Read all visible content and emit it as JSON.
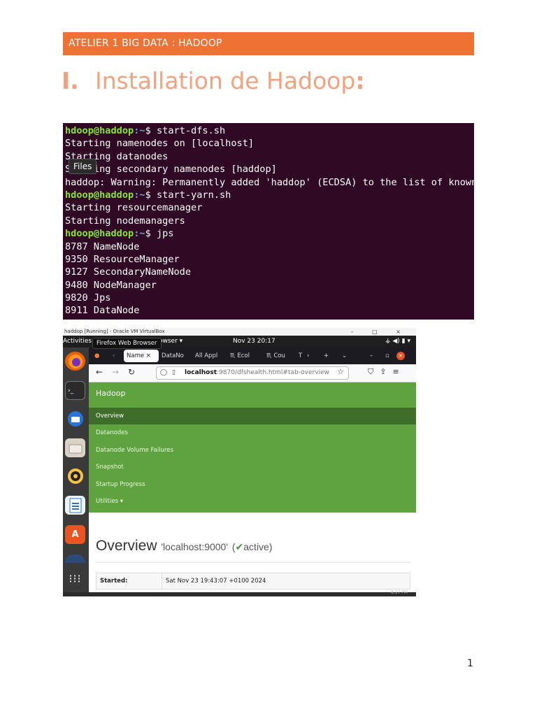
{
  "header": {
    "title": "ATELIER 1 BIG DATA : HADOOP"
  },
  "section": {
    "number": "I.",
    "title": "Installation de Hadoop",
    "colon": ":"
  },
  "terminal": {
    "lines": [
      {
        "user": "hdoop@haddop",
        "path": ":~",
        "text": "$ start-dfs.sh"
      },
      {
        "text": "Starting namenodes on [localhost]"
      },
      {
        "text": "Starting datanodes"
      },
      {
        "text": "Starting secondary namenodes [haddop]"
      },
      {
        "text": "haddop: Warning: Permanently added 'haddop' (ECDSA) to the list of known hosts."
      },
      {
        "user": "hdoop@haddop",
        "path": ":~",
        "text": "$ start-yarn.sh"
      },
      {
        "text": "Starting resourcemanager"
      },
      {
        "text": "Starting nodemanagers"
      },
      {
        "user": "hdoop@haddop",
        "path": ":~",
        "text": "$ jps"
      },
      {
        "text": "8787 NameNode"
      },
      {
        "text": "9350 ResourceManager"
      },
      {
        "text": "9127 SecondaryNameNode"
      },
      {
        "text": "9480 NodeManager"
      },
      {
        "text": "9820 Jps"
      },
      {
        "text": "8911 DataNode"
      }
    ],
    "tooltip": "Files"
  },
  "vm": {
    "window_title": "haddop [Running] - Oracle VM VirtualBox",
    "window_controls": "–  □  ×",
    "gnome": {
      "activities": "Activities",
      "app_menu": "owser ▾",
      "clock": "Nov 23  20:17",
      "tray": "⚶ ◀) ▮ ▾"
    },
    "tooltip": "Firefox Web Browser",
    "tabs": [
      "Name",
      "DataNo",
      "All Appl",
      "Ecol",
      "Cou",
      "T"
    ],
    "tab_close": "×",
    "url": {
      "host": "localhost",
      "rest": ":9870/dfshealth.html#tab-overview"
    },
    "hadoop": {
      "brand": "Hadoop",
      "menu": [
        "Overview",
        "Datanodes",
        "Datanode Volume Failures",
        "Snapshot",
        "Startup Progress",
        "Utilities ▾"
      ],
      "overview_title": "Overview",
      "overview_host": "'localhost:9000'",
      "overview_status_open": "(",
      "overview_check": "✔",
      "overview_status": "active)",
      "started_label": "Started:",
      "started_value": "Sat Nov 23 19:43:07 +0100 2024"
    },
    "taskbar_time": "8:17 PM"
  },
  "page_number": "1"
}
